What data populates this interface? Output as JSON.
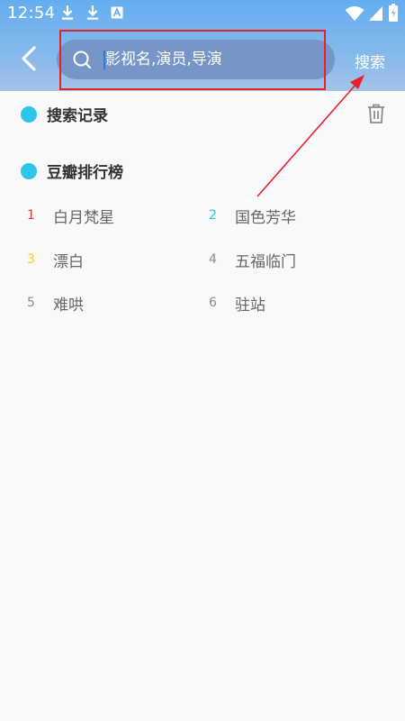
{
  "status_bar": {
    "time": "12:54",
    "left_icons": [
      "download-icon",
      "download-icon",
      "text-a-icon"
    ],
    "right_icons": [
      "wifi-icon",
      "signal-icon",
      "battery-charging-icon"
    ]
  },
  "search": {
    "placeholder": "影视名,演员,导演",
    "value": "",
    "button_label": "搜索"
  },
  "history": {
    "title": "搜索记录",
    "clear_icon": "trash-icon"
  },
  "ranking": {
    "title": "豆瓣排行榜",
    "items": [
      {
        "rank": "1",
        "title": "白月梵星",
        "rank_color": "#e53935"
      },
      {
        "rank": "2",
        "title": "国色芳华",
        "rank_color": "#26c6da"
      },
      {
        "rank": "3",
        "title": "漂白",
        "rank_color": "#f1d21e"
      },
      {
        "rank": "4",
        "title": "五福临门",
        "rank_color": "#8c8c8c"
      },
      {
        "rank": "5",
        "title": "难哄",
        "rank_color": "#8c8c8c"
      },
      {
        "rank": "6",
        "title": "驻站",
        "rank_color": "#8c8c8c"
      }
    ]
  },
  "colors": {
    "header_gradient_top": "#63aef0",
    "accent_dot": "#2bc6ea",
    "annotation_red": "#e8202a"
  }
}
